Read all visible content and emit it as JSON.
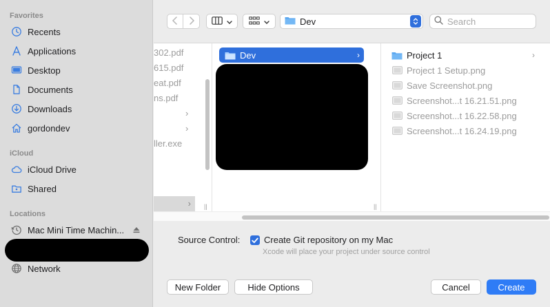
{
  "sidebar": {
    "favorites_header": "Favorites",
    "favorites": [
      {
        "label": "Recents",
        "icon": "clock-icon"
      },
      {
        "label": "Applications",
        "icon": "applications-icon"
      },
      {
        "label": "Desktop",
        "icon": "desktop-icon"
      },
      {
        "label": "Documents",
        "icon": "document-icon"
      },
      {
        "label": "Downloads",
        "icon": "download-icon"
      },
      {
        "label": "gordondev",
        "icon": "home-icon"
      }
    ],
    "icloud_header": "iCloud",
    "icloud": [
      {
        "label": "iCloud Drive",
        "icon": "cloud-icon"
      },
      {
        "label": "Shared",
        "icon": "shared-folder-icon"
      }
    ],
    "locations_header": "Locations",
    "locations": [
      {
        "label": "Mac Mini Time Machin...",
        "icon": "time-machine-icon"
      },
      {
        "label": "Network",
        "icon": "globe-icon"
      }
    ]
  },
  "toolbar": {
    "path_label": "Dev",
    "search_placeholder": "Search"
  },
  "browser": {
    "col1": [
      "302.pdf",
      "615.pdf",
      "eat.pdf",
      "ns.pdf",
      "",
      "",
      "ller.exe"
    ],
    "col2_selected": "Dev",
    "col3": [
      {
        "label": "Project 1",
        "type": "folder"
      },
      {
        "label": "Project 1 Setup.png",
        "type": "image"
      },
      {
        "label": "Save Screenshot.png",
        "type": "image"
      },
      {
        "label": "Screenshot...t 16.21.51.png",
        "type": "image"
      },
      {
        "label": "Screenshot...t 16.22.58.png",
        "type": "image"
      },
      {
        "label": "Screenshot...t 16.24.19.png",
        "type": "image"
      }
    ]
  },
  "options": {
    "source_control_label": "Source Control:",
    "git_checkbox_label": "Create Git repository on my Mac",
    "git_checked": true,
    "hint": "Xcode will place your project under source control"
  },
  "footer": {
    "new_folder": "New Folder",
    "hide_options": "Hide Options",
    "cancel": "Cancel",
    "create": "Create"
  },
  "colors": {
    "accent": "#2f6fdc",
    "primary_button": "#2f7cf6",
    "sidebar_bg": "#dcdcdc",
    "sidebar_icon": "#3a7de0"
  }
}
